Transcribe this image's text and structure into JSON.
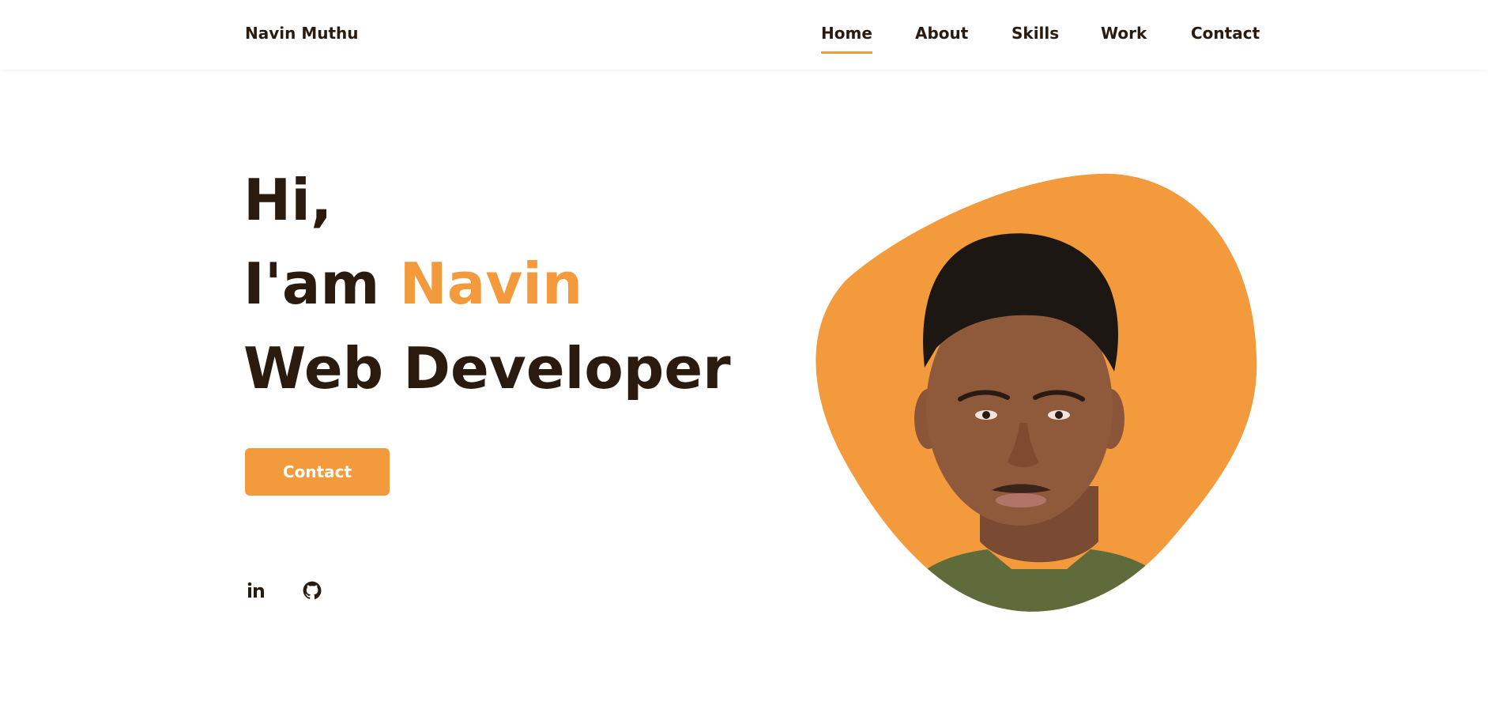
{
  "header": {
    "logo": "Navin Muthu",
    "nav": [
      "Home",
      "About",
      "Skills",
      "Work",
      "Contact"
    ],
    "active_nav": "Home"
  },
  "hero": {
    "line1": "Hi,",
    "line2_prefix": "I'am ",
    "line2_name": "Navin",
    "line3": "Web Developer",
    "cta_label": "Contact"
  },
  "social": {
    "icons": [
      "linkedin-icon",
      "github-icon"
    ]
  },
  "image": {
    "description_icon": "profile-photo"
  },
  "colors": {
    "accent": "#f39a3d",
    "text": "#2a1b0e",
    "background": "#ffffff"
  }
}
